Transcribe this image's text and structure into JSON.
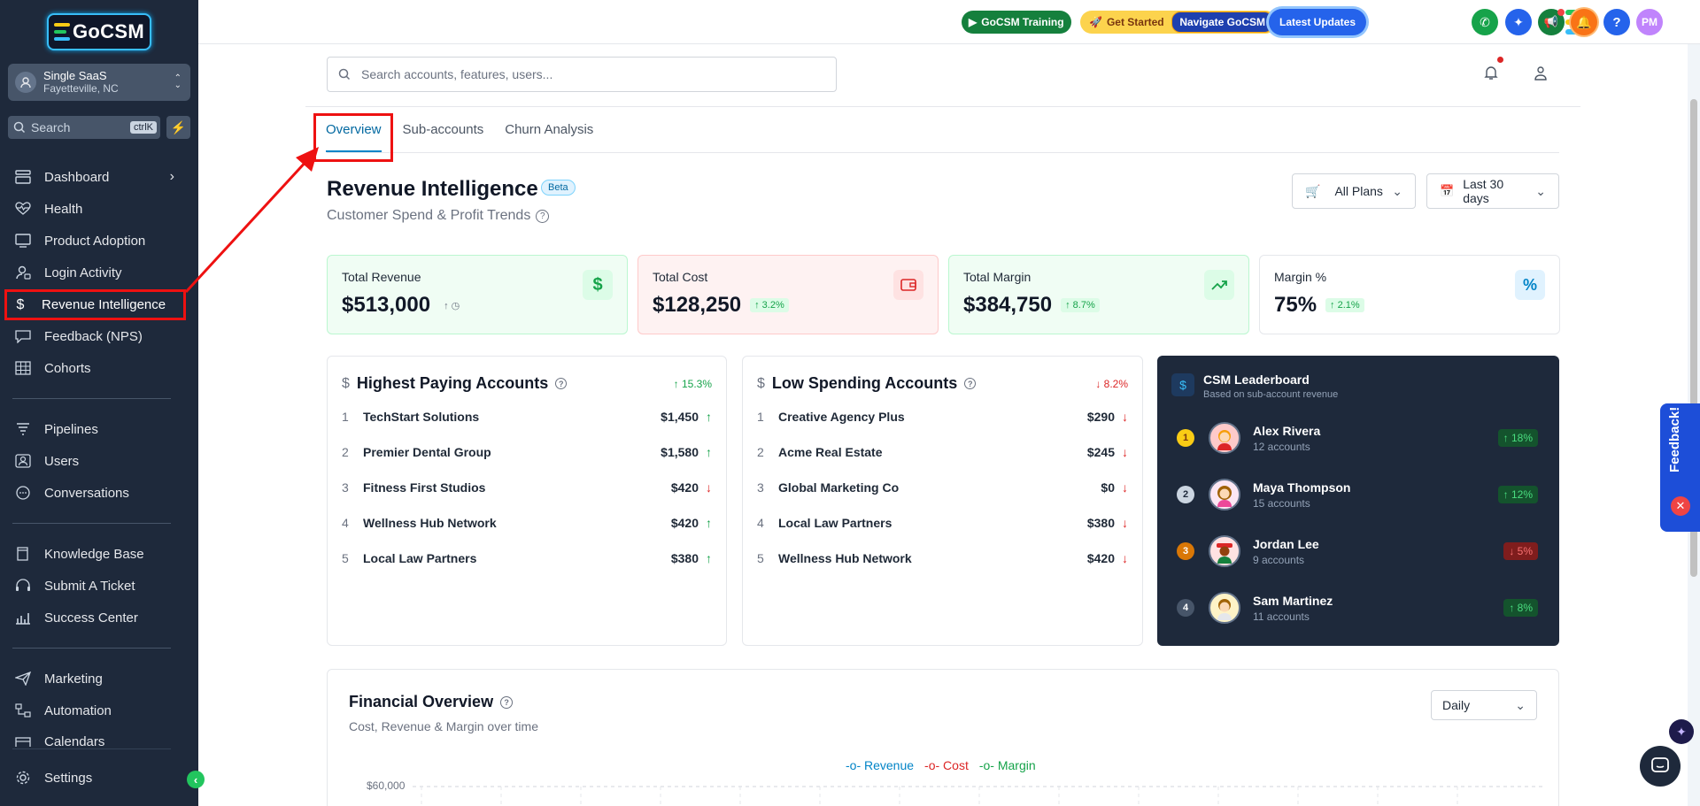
{
  "brand": {
    "name": "GoCSM"
  },
  "location": {
    "name": "Single SaaS",
    "city": "Fayetteville, NC"
  },
  "sidebar": {
    "search_placeholder": "Search",
    "search_shortcut": "ctrlK",
    "items": [
      {
        "label": "Dashboard",
        "icon": "dashboard-icon"
      },
      {
        "label": "Health",
        "icon": "heartbeat-icon"
      },
      {
        "label": "Product Adoption",
        "icon": "monitor-icon"
      },
      {
        "label": "Login Activity",
        "icon": "user-login-icon"
      },
      {
        "label": "Revenue Intelligence",
        "icon": "dollar-icon"
      },
      {
        "label": "Feedback (NPS)",
        "icon": "feedback-icon"
      },
      {
        "label": "Cohorts",
        "icon": "table-icon"
      },
      {
        "label": "Pipelines",
        "icon": "funnel-icon"
      },
      {
        "label": "Users",
        "icon": "user-icon"
      },
      {
        "label": "Conversations",
        "icon": "chat-icon"
      },
      {
        "label": "Knowledge Base",
        "icon": "book-icon"
      },
      {
        "label": "Submit A Ticket",
        "icon": "headset-icon"
      },
      {
        "label": "Success Center",
        "icon": "chart-icon"
      },
      {
        "label": "Marketing",
        "icon": "send-icon"
      },
      {
        "label": "Automation",
        "icon": "automation-icon"
      },
      {
        "label": "Calendars",
        "icon": "calendar-icon"
      },
      {
        "label": "Settings",
        "icon": "gear-icon"
      }
    ]
  },
  "topbar": {
    "training": "GoCSM Training",
    "get_started": "Get Started",
    "navigate": "Navigate GoCSM",
    "updates": "Latest Updates",
    "avatar_initials": "PM"
  },
  "header": {
    "search_placeholder": "Search accounts, features, users..."
  },
  "tabs": [
    "Overview",
    "Sub-accounts",
    "Churn Analysis"
  ],
  "page": {
    "title": "Revenue Intelligence",
    "badge": "Beta",
    "subtitle": "Customer Spend & Profit Trends"
  },
  "filters": {
    "plans": "All Plans",
    "range": "Last 30 days"
  },
  "stats": [
    {
      "label": "Total Revenue",
      "value": "$513,000",
      "change": "↑",
      "color": "#16a34a"
    },
    {
      "label": "Total Cost",
      "value": "$128,250",
      "change": "↑ 3.2%",
      "color": "#dc2626"
    },
    {
      "label": "Total Margin",
      "value": "$384,750",
      "change": "↑ 8.7%",
      "color": "#16a34a"
    },
    {
      "label": "Margin %",
      "value": "75%",
      "change": "↑ 2.1%",
      "color": "#0284c7"
    }
  ],
  "highest": {
    "title": "Highest Paying Accounts",
    "change": "↑ 15.3%",
    "rows": [
      {
        "n": "1",
        "name": "TechStart Solutions",
        "value": "$1,450",
        "dir": "↑"
      },
      {
        "n": "2",
        "name": "Premier Dental Group",
        "value": "$1,580",
        "dir": "↑"
      },
      {
        "n": "3",
        "name": "Fitness First Studios",
        "value": "$420",
        "dir": "↓"
      },
      {
        "n": "4",
        "name": "Wellness Hub Network",
        "value": "$420",
        "dir": "↑"
      },
      {
        "n": "5",
        "name": "Local Law Partners",
        "value": "$380",
        "dir": "↑"
      }
    ]
  },
  "lowest": {
    "title": "Low Spending Accounts",
    "change": "↓ 8.2%",
    "rows": [
      {
        "n": "1",
        "name": "Creative Agency Plus",
        "value": "$290",
        "dir": "↓"
      },
      {
        "n": "2",
        "name": "Acme Real Estate",
        "value": "$245",
        "dir": "↓"
      },
      {
        "n": "3",
        "name": "Global Marketing Co",
        "value": "$0",
        "dir": "↓"
      },
      {
        "n": "4",
        "name": "Local Law Partners",
        "value": "$380",
        "dir": "↓"
      },
      {
        "n": "5",
        "name": "Wellness Hub Network",
        "value": "$420",
        "dir": "↓"
      }
    ]
  },
  "leaderboard": {
    "title": "CSM Leaderboard",
    "subtitle": "Based on sub-account revenue",
    "rows": [
      {
        "rank": "1",
        "name": "Alex Rivera",
        "accounts": "12 accounts",
        "change": "↑ 18%"
      },
      {
        "rank": "2",
        "name": "Maya Thompson",
        "accounts": "15 accounts",
        "change": "↑ 12%"
      },
      {
        "rank": "3",
        "name": "Jordan Lee",
        "accounts": "9 accounts",
        "change": "↓ 5%"
      },
      {
        "rank": "4",
        "name": "Sam Martinez",
        "accounts": "11 accounts",
        "change": "↑ 8%"
      }
    ]
  },
  "financial": {
    "title": "Financial Overview",
    "subtitle": "Cost, Revenue & Margin over time",
    "granularity": "Daily",
    "legend": [
      "Revenue",
      "Cost",
      "Margin"
    ],
    "y_tick": "$60,000"
  },
  "feedback_tab": "Feedback!"
}
